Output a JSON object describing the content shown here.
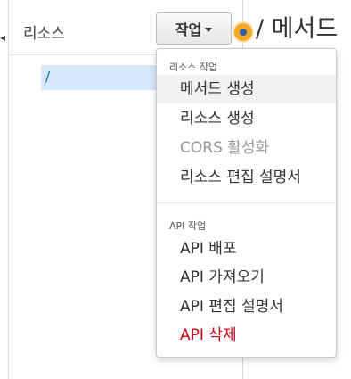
{
  "panel": {
    "title": "리소스",
    "actions_label": "작업",
    "resource_path": "/"
  },
  "page": {
    "title": "/ 메서드"
  },
  "menu": {
    "resource_section": {
      "header": "리소스 작업",
      "items": [
        {
          "label": "메서드 생성"
        },
        {
          "label": "리소스 생성"
        },
        {
          "label": "CORS 활성화"
        },
        {
          "label": "리소스 편집 설명서"
        }
      ]
    },
    "api_section": {
      "header": "API 작업",
      "items": [
        {
          "label": "API 배포"
        },
        {
          "label": "API 가져오기"
        },
        {
          "label": "API 편집 설명서"
        },
        {
          "label": "API 삭제"
        }
      ]
    }
  },
  "colors": {
    "danger": "#d0021b",
    "selected_row": "#d6e8fb",
    "hint_dot": "#f6a623"
  }
}
